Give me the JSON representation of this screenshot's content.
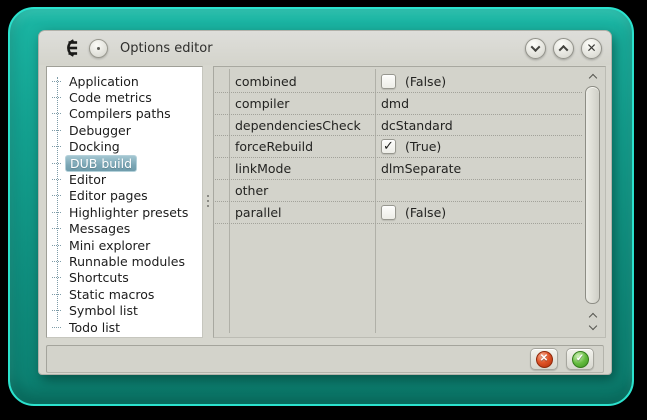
{
  "window": {
    "title": "Options editor"
  },
  "titlebar": {
    "app_icon": "coedit-logo-icon",
    "menu_button": "window-menu",
    "close_glyph": "✕",
    "buttons": [
      "shade",
      "maximize",
      "close"
    ]
  },
  "sidebar": {
    "items": [
      {
        "label": "Application",
        "selected": false
      },
      {
        "label": "Code metrics",
        "selected": false
      },
      {
        "label": "Compilers paths",
        "selected": false
      },
      {
        "label": "Debugger",
        "selected": false
      },
      {
        "label": "Docking",
        "selected": false
      },
      {
        "label": "DUB build",
        "selected": true
      },
      {
        "label": "Editor",
        "selected": false
      },
      {
        "label": "Editor pages",
        "selected": false
      },
      {
        "label": "Highlighter presets",
        "selected": false
      },
      {
        "label": "Messages",
        "selected": false
      },
      {
        "label": "Mini explorer",
        "selected": false
      },
      {
        "label": "Runnable modules",
        "selected": false
      },
      {
        "label": "Shortcuts",
        "selected": false
      },
      {
        "label": "Static macros",
        "selected": false
      },
      {
        "label": "Symbol list",
        "selected": false
      },
      {
        "label": "Todo list",
        "selected": false
      }
    ]
  },
  "property_grid": {
    "rows": [
      {
        "name": "combined",
        "type": "bool",
        "checked": false,
        "value": "(False)"
      },
      {
        "name": "compiler",
        "type": "text",
        "value": "dmd"
      },
      {
        "name": "dependenciesCheck",
        "type": "text",
        "value": "dcStandard"
      },
      {
        "name": "forceRebuild",
        "type": "bool",
        "checked": true,
        "value": "(True)"
      },
      {
        "name": "linkMode",
        "type": "text",
        "value": "dlmSeparate"
      },
      {
        "name": "other",
        "type": "text",
        "value": ""
      },
      {
        "name": "parallel",
        "type": "bool",
        "checked": false,
        "value": "(False)"
      }
    ],
    "check_glyph": "✓"
  },
  "footer": {
    "cancel_glyph": "✕",
    "accept_glyph": "✓"
  },
  "colors": {
    "desktop_teal": "#14a392",
    "desktop_edge_cyan": "#2be2cd",
    "window_gray": "#d6d6ce",
    "selection_teal": "#7ba6b5",
    "cancel_red": "#cc3a14",
    "accept_green": "#4aa02c"
  }
}
